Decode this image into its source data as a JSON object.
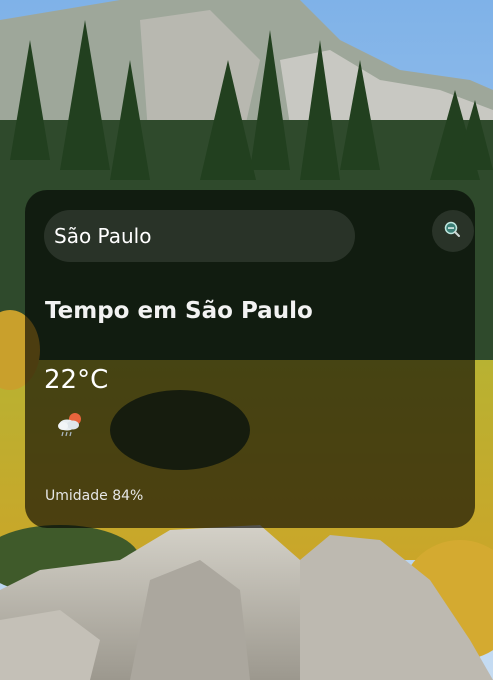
{
  "search": {
    "value": "São Paulo",
    "placeholder": "São Paulo"
  },
  "weather": {
    "title": "Tempo em São Paulo",
    "temperature": "22°C",
    "condition_icon": "cloud-rain-sun-icon",
    "humidity_label": "Umidade",
    "humidity_value": "84%"
  },
  "icons": {
    "search_button": "search-icon"
  },
  "colors": {
    "card_background": "#000000",
    "text_primary": "#ffffff",
    "sun_accent": "#e8643c",
    "cloud": "#e9eef2"
  }
}
